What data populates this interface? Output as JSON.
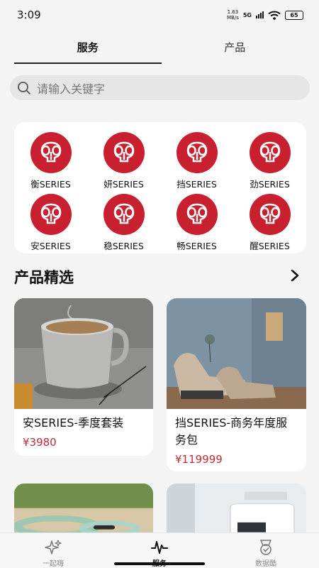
{
  "status": {
    "time": "3:09",
    "net_speed": "1.63",
    "net_unit": "MB/s",
    "network": "5G",
    "battery": "65"
  },
  "tabs": [
    {
      "label": "服务",
      "active": true
    },
    {
      "label": "产品",
      "active": false
    }
  ],
  "search": {
    "placeholder": "请输入关键字"
  },
  "series": [
    {
      "label": "衡SERIES",
      "icon": "elephant-logo-icon"
    },
    {
      "label": "妍SERIES",
      "icon": "elephant-logo-icon"
    },
    {
      "label": "挡SERIES",
      "icon": "elephant-logo-icon"
    },
    {
      "label": "劲SERIES",
      "icon": "elephant-logo-icon"
    },
    {
      "label": "安SERIES",
      "icon": "elephant-logo-icon"
    },
    {
      "label": "稳SERIES",
      "icon": "elephant-logo-icon"
    },
    {
      "label": "畅SERIES",
      "icon": "elephant-logo-icon"
    },
    {
      "label": "醒SERIES",
      "icon": "elephant-logo-icon"
    }
  ],
  "section": {
    "title": "产品精选",
    "more_icon": "chevron-right-icon"
  },
  "products": [
    {
      "name": "安SERIES-季度套装",
      "price": "¥3980"
    },
    {
      "name": "挡SERIES-商务年度服务包",
      "price": "¥119999"
    },
    {
      "name": "",
      "price": ""
    },
    {
      "name": "",
      "price": ""
    }
  ],
  "nav": [
    {
      "label": "一起嗨",
      "icon": "sparkle-icon",
      "active": false
    },
    {
      "label": "服务",
      "icon": "pulse-icon",
      "active": true
    },
    {
      "label": "数据酷",
      "icon": "medal-icon",
      "active": false
    }
  ],
  "colors": {
    "brand_red": "#c8202f",
    "price_red": "#c22b36"
  }
}
